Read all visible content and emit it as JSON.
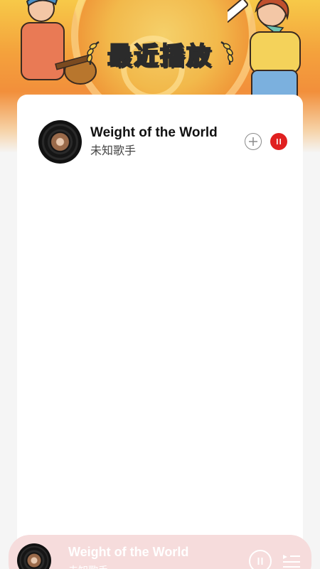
{
  "header": {
    "title": "最近播放"
  },
  "recent_list": [
    {
      "title": "Weight of the World",
      "artist": "未知歌手",
      "cover_icon": "vinyl-disc-icon",
      "add_icon": "plus-circle-icon",
      "status_icon": "pause-icon"
    }
  ],
  "player": {
    "title": "Weight of the World",
    "artist": "未知歌手",
    "pause_icon": "pause-icon",
    "playlist_icon": "playlist-icon"
  },
  "colors": {
    "accent": "#e02020",
    "banner_top": "#f7c948",
    "banner_mid": "#f28f3b",
    "player_bg": "#f6dcdc"
  }
}
